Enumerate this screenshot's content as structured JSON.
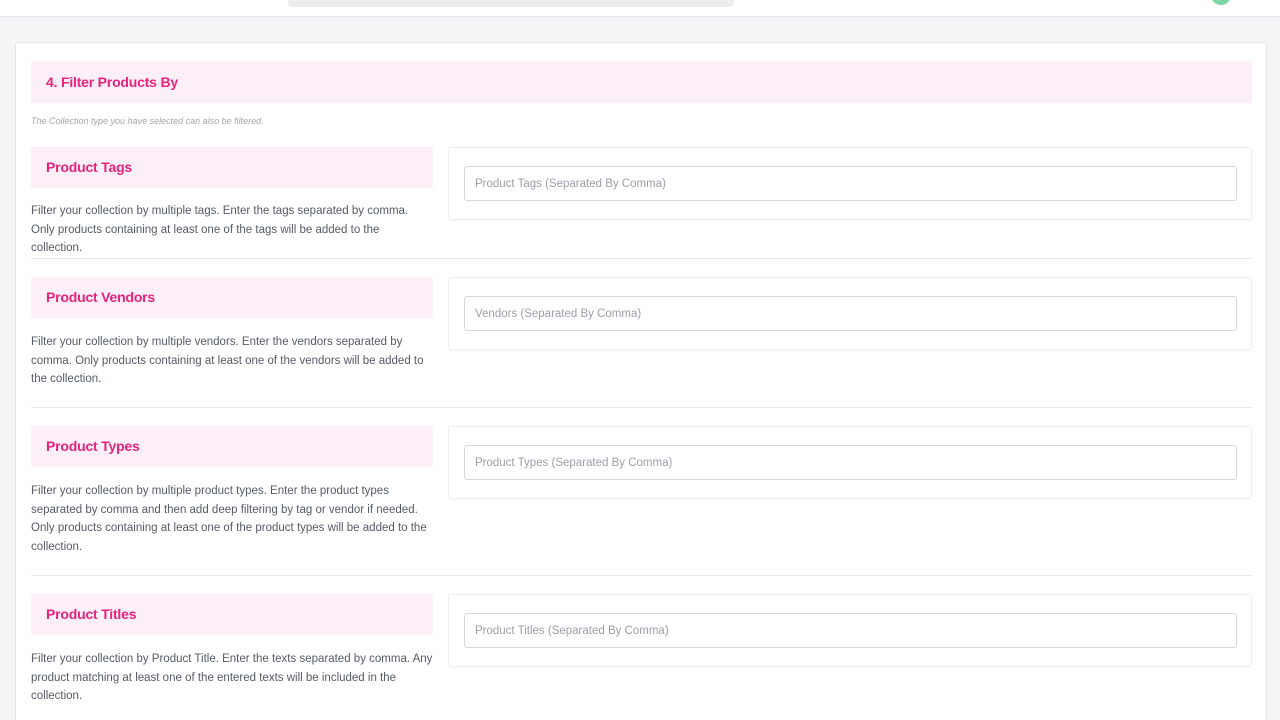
{
  "section": {
    "title": "4. Filter Products By",
    "note": "The Collection type you have selected can also be filtered."
  },
  "filters": [
    {
      "label": "Product Tags",
      "description": "Filter your collection by multiple tags. Enter the tags separated by comma. Only products containing at least one of the tags will be added to the collection.",
      "placeholder": "Product Tags (Separated By Comma)",
      "value": ""
    },
    {
      "label": "Product Vendors",
      "description": "Filter your collection by multiple vendors. Enter the vendors separated by comma. Only products containing at least one of the vendors will be added to the collection.",
      "placeholder": "Vendors (Separated By Comma)",
      "value": ""
    },
    {
      "label": "Product Types",
      "description": "Filter your collection by multiple product types. Enter the product types separated by comma and then add deep filtering by tag or vendor if needed. Only products containing at least one of the product types will be added to the collection.",
      "placeholder": "Product Types (Separated By Comma)",
      "value": ""
    },
    {
      "label": "Product Titles",
      "description": "Filter your collection by Product Title. Enter the texts separated by comma. Any product matching at least one of the entered texts will be included in the collection.",
      "placeholder": "Product Titles (Separated By Comma)",
      "value": ""
    }
  ],
  "colors": {
    "accent": "#e8237d",
    "label_background": "#fdeff7",
    "status_indicator": "#7fd7a3"
  }
}
